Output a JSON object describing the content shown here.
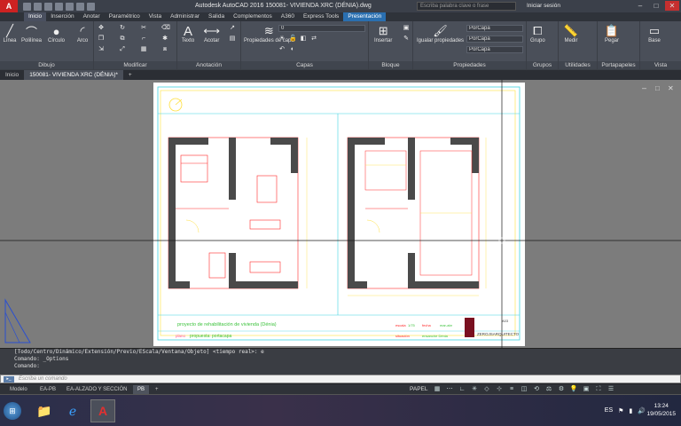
{
  "titlebar": {
    "app_logo": "A",
    "title": "Autodesk AutoCAD 2016   150081- VIVIENDA XRC (DÉNIA).dwg",
    "search_placeholder": "Escriba palabra clave o frase",
    "login": "Iniciar sesión",
    "minimize": "–",
    "maximize": "□",
    "close": "✕"
  },
  "ribbon_tabs": [
    "Inicio",
    "Inserción",
    "Anotar",
    "Paramétrico",
    "Vista",
    "Administrar",
    "Salida",
    "Complementos",
    "A360",
    "Express Tools",
    "Presentación"
  ],
  "ribbon": {
    "draw": {
      "title": "Dibujo",
      "linea": "Línea",
      "polilinea": "Polilínea",
      "circulo": "Círculo",
      "arco": "Arco"
    },
    "modify": {
      "title": "Modificar"
    },
    "annotation": {
      "title": "Anotación",
      "texto": "Texto",
      "acotar": "Acotar"
    },
    "layers": {
      "title": "Capas",
      "props": "Propiedades de capa",
      "layer_value": "0"
    },
    "block": {
      "title": "Bloque",
      "insertar": "Insertar"
    },
    "properties": {
      "title": "Propiedades",
      "igualar": "Igualar propiedades",
      "color": "PorCapa",
      "linetype": "PorCapa",
      "lineweight": "PorCapa"
    },
    "groups": {
      "title": "Grupos",
      "grupo": "Grupo"
    },
    "utilities": {
      "title": "Utilidades",
      "medir": "Medir"
    },
    "clipboard": {
      "title": "Portapapeles",
      "pegar": "Pegar"
    },
    "view": {
      "title": "Vista",
      "base": "Base"
    }
  },
  "doc_tabs": [
    "Inicio",
    "150081- VIVIENDA XRC (DÉNIA)*"
  ],
  "doc_tab_add": "+",
  "viewport_controls": [
    "–",
    "□",
    "✕"
  ],
  "sheet": {
    "project_title": "proyecto de rehabilitación de vivienda (Dénia)",
    "plano_label": "plano",
    "plano_value": "propuesta: portacapa",
    "escala_label": "escala",
    "escala_value": "1/75",
    "fecha_label": "fecha",
    "fecha_value": "mar-abr",
    "situacion_label": "situación",
    "situacion_value": "ensanche Dénia",
    "firm": "ZEROJSARQUITECTO",
    "sheet_num": "A03"
  },
  "command": {
    "lines": [
      "[Todo/Centro/Dinámico/Extensión/Previo/EScala/Ventana/Objeto] <tiempo real>: e",
      "Comando: _Options",
      "Comando:"
    ],
    "input_placeholder": "Escriba un comando",
    "icon_label": "▸_"
  },
  "layout_tabs": [
    "Modelo",
    "EA-PB",
    "EA-ALZADO Y SECCIÓN",
    "PB"
  ],
  "layout_tab_add": "+",
  "status": {
    "papel": "PAPEL"
  },
  "taskbar": {
    "lang": "ES",
    "time": "13:24",
    "date": "19/05/2015"
  },
  "colors": {
    "accent": "#2a6fb0",
    "wall": "#4a4a4a",
    "red_line": "#ff2a2a",
    "cyan": "#3fd3e0",
    "yellow": "#ffdf3a"
  }
}
